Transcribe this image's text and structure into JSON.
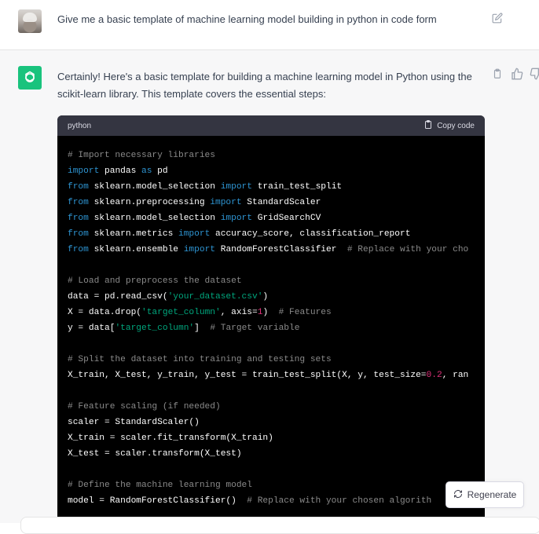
{
  "user": {
    "message": "Give me a basic template of machine learning model building in python in code form"
  },
  "assistant": {
    "message": "Certainly! Here's a basic template for building a machine learning model in Python using the scikit-learn library. This template covers the essential steps:"
  },
  "code_block": {
    "language": "python",
    "copy_label": "Copy code",
    "lines": [
      [
        {
          "t": "# Import necessary libraries",
          "c": "comment"
        }
      ],
      [
        {
          "t": "import",
          "c": "kw"
        },
        {
          "t": " pandas "
        },
        {
          "t": "as",
          "c": "kw"
        },
        {
          "t": " pd"
        }
      ],
      [
        {
          "t": "from",
          "c": "kw"
        },
        {
          "t": " sklearn.model_selection "
        },
        {
          "t": "import",
          "c": "kw"
        },
        {
          "t": " train_test_split"
        }
      ],
      [
        {
          "t": "from",
          "c": "kw"
        },
        {
          "t": " sklearn.preprocessing "
        },
        {
          "t": "import",
          "c": "kw"
        },
        {
          "t": " StandardScaler"
        }
      ],
      [
        {
          "t": "from",
          "c": "kw"
        },
        {
          "t": " sklearn.model_selection "
        },
        {
          "t": "import",
          "c": "kw"
        },
        {
          "t": " GridSearchCV"
        }
      ],
      [
        {
          "t": "from",
          "c": "kw"
        },
        {
          "t": " sklearn.metrics "
        },
        {
          "t": "import",
          "c": "kw"
        },
        {
          "t": " accuracy_score, classification_report"
        }
      ],
      [
        {
          "t": "from",
          "c": "kw"
        },
        {
          "t": " sklearn.ensemble "
        },
        {
          "t": "import",
          "c": "kw"
        },
        {
          "t": " RandomForestClassifier  "
        },
        {
          "t": "# Replace with your cho",
          "c": "comment"
        }
      ],
      [],
      [
        {
          "t": "# Load and preprocess the dataset",
          "c": "comment"
        }
      ],
      [
        {
          "t": "data = pd.read_csv("
        },
        {
          "t": "'your_dataset.csv'",
          "c": "str"
        },
        {
          "t": ")"
        }
      ],
      [
        {
          "t": "X = data.drop("
        },
        {
          "t": "'target_column'",
          "c": "str"
        },
        {
          "t": ", axis="
        },
        {
          "t": "1",
          "c": "num"
        },
        {
          "t": ")  "
        },
        {
          "t": "# Features",
          "c": "comment"
        }
      ],
      [
        {
          "t": "y = data["
        },
        {
          "t": "'target_column'",
          "c": "str"
        },
        {
          "t": "]  "
        },
        {
          "t": "# Target variable",
          "c": "comment"
        }
      ],
      [],
      [
        {
          "t": "# Split the dataset into training and testing sets",
          "c": "comment"
        }
      ],
      [
        {
          "t": "X_train, X_test, y_train, y_test = train_test_split(X, y, test_size="
        },
        {
          "t": "0.2",
          "c": "num"
        },
        {
          "t": ", ran"
        }
      ],
      [],
      [
        {
          "t": "# Feature scaling (if needed)",
          "c": "comment"
        }
      ],
      [
        {
          "t": "scaler = StandardScaler()"
        }
      ],
      [
        {
          "t": "X_train = scaler.fit_transform(X_train)"
        }
      ],
      [
        {
          "t": "X_test = scaler.transform(X_test)"
        }
      ],
      [],
      [
        {
          "t": "# Define the machine learning model",
          "c": "comment"
        }
      ],
      [
        {
          "t": "model = RandomForestClassifier()  "
        },
        {
          "t": "# Replace with your chosen algorith",
          "c": "comment"
        }
      ]
    ]
  },
  "regenerate_label": "Regenerate"
}
